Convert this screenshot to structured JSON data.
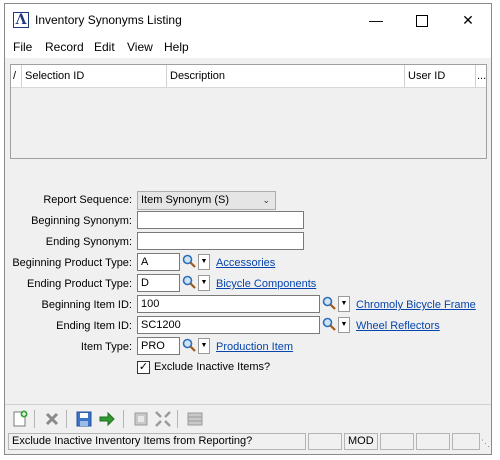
{
  "window": {
    "title": "Inventory Synonyms Listing"
  },
  "menu": [
    "File",
    "Record",
    "Edit",
    "View",
    "Help"
  ],
  "grid": {
    "sort_marker": "/",
    "columns": [
      "Selection ID",
      "Description",
      "User ID",
      "..."
    ]
  },
  "form": {
    "report_sequence": {
      "label": "Report Sequence:",
      "value": "Item Synonym (S)"
    },
    "beginning_synonym": {
      "label": "Beginning Synonym:",
      "value": ""
    },
    "ending_synonym": {
      "label": "Ending Synonym:",
      "value": ""
    },
    "beginning_product_type": {
      "label": "Beginning Product Type:",
      "value": "A",
      "description": "Accessories"
    },
    "ending_product_type": {
      "label": "Ending Product Type:",
      "value": "D",
      "description": "Bicycle Components"
    },
    "beginning_item_id": {
      "label": "Beginning Item ID:",
      "value": "100",
      "description": "Chromoly Bicycle Frame"
    },
    "ending_item_id": {
      "label": "Ending Item ID:",
      "value": "SC1200",
      "description": "Wheel Reflectors"
    },
    "item_type": {
      "label": "Item Type:",
      "value": "PRO",
      "description": "Production Item"
    },
    "exclude_inactive": {
      "label": "Exclude Inactive Items?",
      "checked": true
    }
  },
  "status": {
    "message": "Exclude Inactive Inventory Items from Reporting?",
    "mode": "MOD"
  },
  "colors": {
    "link": "#0645ad",
    "window_bg": "#f0f0f0",
    "brand": "#1f3a7a"
  }
}
